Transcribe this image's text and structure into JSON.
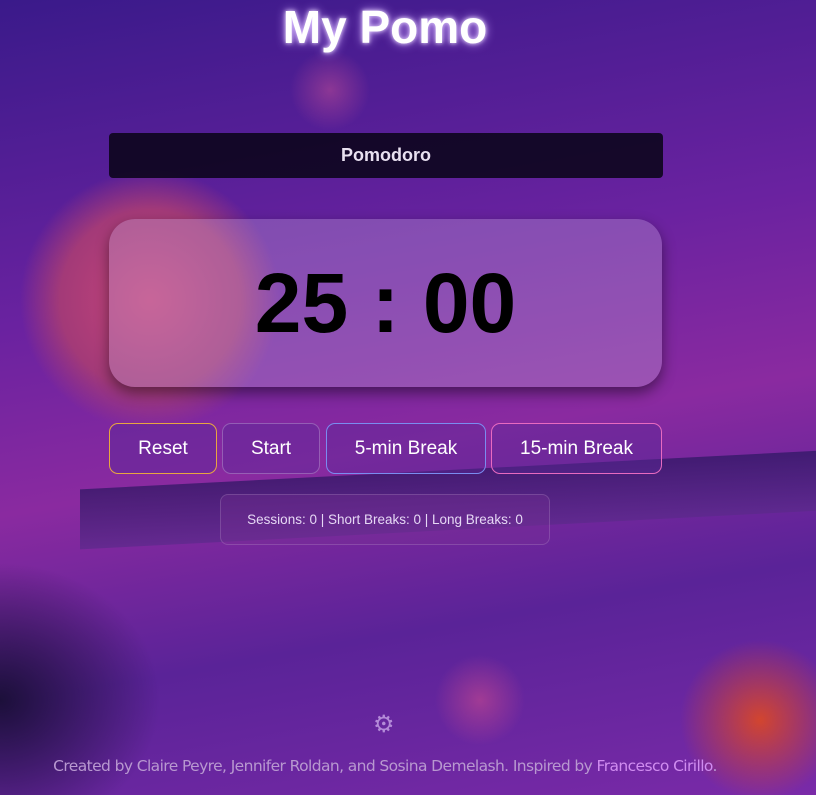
{
  "title": "My Pomo",
  "mode": "Pomodoro",
  "timer": {
    "minutes": "25",
    "separator": ":",
    "seconds": "00",
    "display": "25 : 00"
  },
  "buttons": {
    "reset": "Reset",
    "start": "Start",
    "short_break": "5-min Break",
    "long_break": "15-min Break"
  },
  "stats": "Sessions: 0 | Short Breaks: 0 | Long Breaks: 0",
  "settings_icon": "gear-icon",
  "footer": {
    "text": "Created by Claire Peyre, Jennifer Roldan, and Sosina Demelash. Inspired by ",
    "link": "Francesco Cirillo",
    "end": "."
  }
}
